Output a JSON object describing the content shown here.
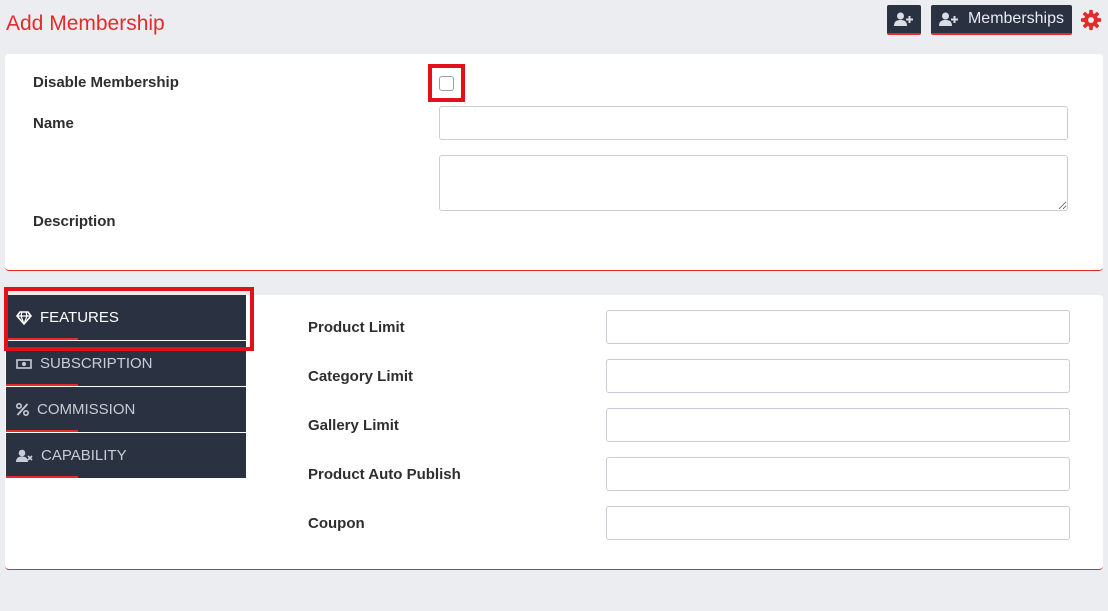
{
  "page": {
    "title": "Add Membership"
  },
  "toolbar": {
    "memberships_label": "Memberships"
  },
  "form": {
    "disable_label": "Disable Membership",
    "name_label": "Name",
    "name_value": "",
    "description_label": "Description",
    "description_value": ""
  },
  "tabs": [
    {
      "label": "FEATURES",
      "icon": "diamond-icon",
      "active": true
    },
    {
      "label": "SUBSCRIPTION",
      "icon": "money-icon",
      "active": false
    },
    {
      "label": "COMMISSION",
      "icon": "percent-icon",
      "active": false
    },
    {
      "label": "CAPABILITY",
      "icon": "user-x-icon",
      "active": false
    }
  ],
  "features": {
    "product_limit": "Product Limit",
    "category_limit": "Category Limit",
    "gallery_limit": "Gallery Limit",
    "product_auto_publish": "Product Auto Publish",
    "coupon": "Coupon"
  },
  "colors": {
    "accent": "#e32b2b",
    "dark": "#2a3242",
    "highlight": "#e3101b"
  }
}
